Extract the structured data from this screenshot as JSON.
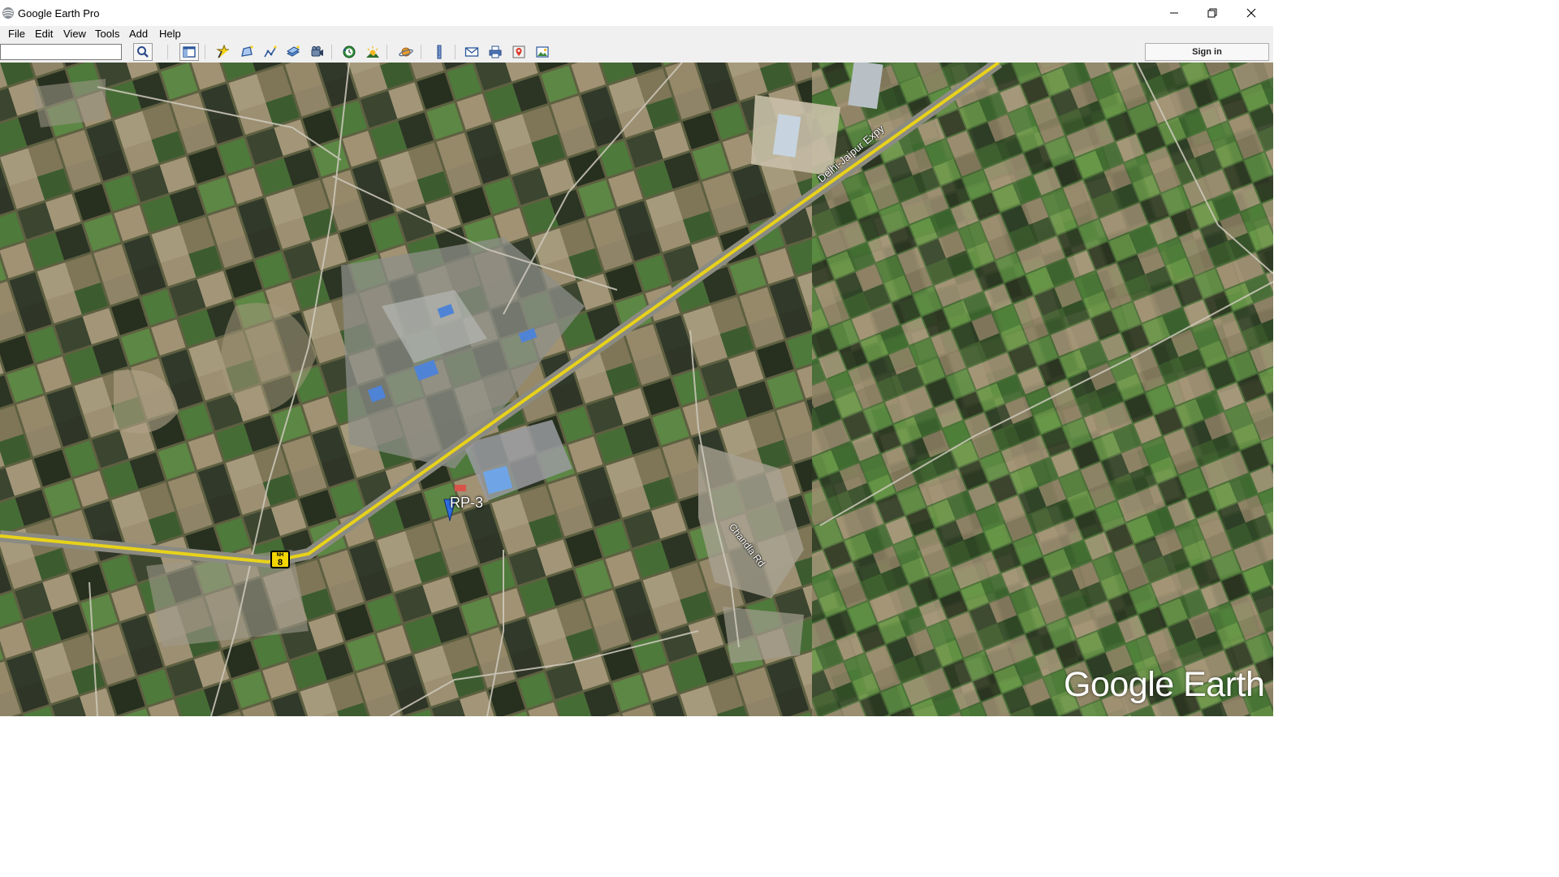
{
  "window": {
    "title": "Google Earth Pro",
    "icon": "google-earth-globe-icon",
    "controls": [
      "minimize-icon",
      "restore-icon",
      "close-icon"
    ]
  },
  "menu": [
    {
      "label": "File"
    },
    {
      "label": "Edit"
    },
    {
      "label": "View"
    },
    {
      "label": "Tools"
    },
    {
      "label": "Add"
    },
    {
      "label": "Help"
    }
  ],
  "toolbar": {
    "search_value": "",
    "search_button_icon": "search-icon",
    "sign_in_label": "Sign in",
    "tools": [
      "sidebar-toggle-icon",
      "add-placemark-icon",
      "add-polygon-icon",
      "add-path-icon",
      "add-image-overlay-icon",
      "record-tour-icon",
      "historical-imagery-icon",
      "sunlight-icon",
      "planets-icon",
      "ruler-icon",
      "email-icon",
      "print-icon",
      "view-in-google-maps-icon",
      "save-image-icon"
    ]
  },
  "map": {
    "highway_label": "Delhi-Jaipur Expy",
    "road_label": "Chandla Rd",
    "placemark_label": "RP-3",
    "route_shield": {
      "prefix": "NH",
      "number": "8"
    },
    "brand_text": "Google Earth"
  },
  "colors": {
    "titlebar": "#ffffff",
    "menubar": "#f0f0f0",
    "field_green": "#3f6b32",
    "field_tan": "#9c8b6c",
    "road_yellow": "#e8d21a",
    "placemark_blue": "#2e6de0"
  }
}
